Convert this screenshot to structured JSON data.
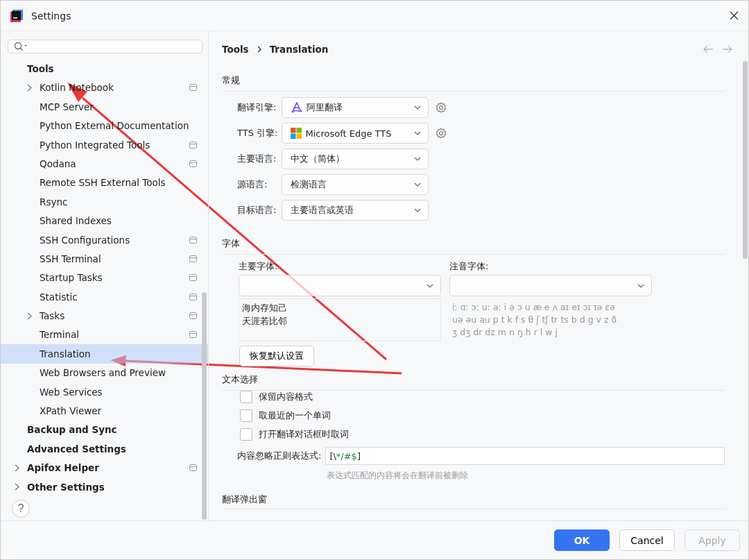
{
  "window": {
    "title": "Settings"
  },
  "sidebar": {
    "items": [
      {
        "label": "Tools",
        "bold": true,
        "has_arrow": false,
        "project_icon": false,
        "selected": false,
        "children": [
          {
            "label": "Kotlin Notebook",
            "has_arrow": true,
            "project_icon": true,
            "selected": false
          },
          {
            "label": "MCP Server",
            "has_arrow": false,
            "project_icon": false,
            "selected": false
          },
          {
            "label": "Python External Documentation",
            "has_arrow": false,
            "project_icon": false,
            "selected": false
          },
          {
            "label": "Python Integrated Tools",
            "has_arrow": false,
            "project_icon": true,
            "selected": false
          },
          {
            "label": "Qodana",
            "has_arrow": false,
            "project_icon": true,
            "selected": false
          },
          {
            "label": "Remote SSH External Tools",
            "has_arrow": false,
            "project_icon": false,
            "selected": false
          },
          {
            "label": "Rsync",
            "has_arrow": false,
            "project_icon": false,
            "selected": false
          },
          {
            "label": "Shared Indexes",
            "has_arrow": false,
            "project_icon": false,
            "selected": false
          },
          {
            "label": "SSH Configurations",
            "has_arrow": false,
            "project_icon": true,
            "selected": false
          },
          {
            "label": "SSH Terminal",
            "has_arrow": false,
            "project_icon": true,
            "selected": false
          },
          {
            "label": "Startup Tasks",
            "has_arrow": false,
            "project_icon": true,
            "selected": false
          },
          {
            "label": "Statistic",
            "has_arrow": false,
            "project_icon": true,
            "selected": false
          },
          {
            "label": "Tasks",
            "has_arrow": true,
            "project_icon": true,
            "selected": false
          },
          {
            "label": "Terminal",
            "has_arrow": false,
            "project_icon": true,
            "selected": false
          },
          {
            "label": "Translation",
            "has_arrow": false,
            "project_icon": false,
            "selected": true
          },
          {
            "label": "Web Browsers and Preview",
            "has_arrow": false,
            "project_icon": false,
            "selected": false
          },
          {
            "label": "Web Services",
            "has_arrow": false,
            "project_icon": false,
            "selected": false
          },
          {
            "label": "XPath Viewer",
            "has_arrow": false,
            "project_icon": false,
            "selected": false
          }
        ]
      },
      {
        "label": "Backup and Sync",
        "bold": true,
        "has_arrow": false,
        "project_icon": false,
        "selected": false
      },
      {
        "label": "Advanced Settings",
        "bold": true,
        "has_arrow": false,
        "project_icon": false,
        "selected": false
      },
      {
        "label": "Apifox Helper",
        "bold": true,
        "has_arrow": true,
        "project_icon": true,
        "selected": false
      },
      {
        "label": "Other Settings",
        "bold": true,
        "has_arrow": true,
        "project_icon": false,
        "selected": false
      }
    ],
    "help": "?"
  },
  "breadcrumb": [
    "Tools",
    "Translation"
  ],
  "general": {
    "heading": "常规",
    "rows": [
      {
        "label": "翻译引擎:",
        "value": "阿里翻译",
        "gear": true
      },
      {
        "label": "TTS 引擎:",
        "value": "Microsoft Edge TTS",
        "gear": true
      },
      {
        "label": "主要语言:",
        "value": "中文（简体）",
        "gear": false
      },
      {
        "label": "源语言:",
        "value": "检测语言",
        "gear": false
      },
      {
        "label": "目标语言:",
        "value": "主要语言或英语",
        "gear": false
      }
    ]
  },
  "fonts": {
    "heading": "字体",
    "primary": {
      "label": "主要字体:",
      "preview": [
        "海内存知己",
        "天涯若比邻"
      ]
    },
    "phonetic": {
      "label": "注音字体:",
      "preview": [
        "iː ɑː ɔː uː aː i ə ɔ u æ e ʌ aɪ eɪ ɔɪ ɪə ɛə",
        "uə əu au p t k f s θ ʃ tʃ tr ts b d g v z ð",
        "ʒ dʒ dr dz m n ŋ h r l w j"
      ]
    },
    "reset_button": "恢复默认设置"
  },
  "text_selection": {
    "heading": "文本选择",
    "checkboxes": [
      {
        "label": "保留内容格式",
        "checked": false
      },
      {
        "label": "取最近的一个单词",
        "checked": false
      },
      {
        "label": "打开翻译对话框时取词",
        "checked": false
      }
    ],
    "regex": {
      "label": "内容忽略正则表达式:",
      "value": [
        {
          "text": "[\\",
          "kind": "plain"
        },
        {
          "text": "*/#$",
          "kind": "literal"
        },
        {
          "text": "]",
          "kind": "plain"
        }
      ],
      "hint": "表达式匹配的内容将会在翻译前被删除"
    }
  },
  "next_section": {
    "heading": "翻译弹出窗"
  },
  "buttons": [
    {
      "label": "OK",
      "kind": "primary",
      "disabled": false
    },
    {
      "label": "Cancel",
      "kind": "normal",
      "disabled": false
    },
    {
      "label": "Apply",
      "kind": "normal",
      "disabled": true
    }
  ]
}
